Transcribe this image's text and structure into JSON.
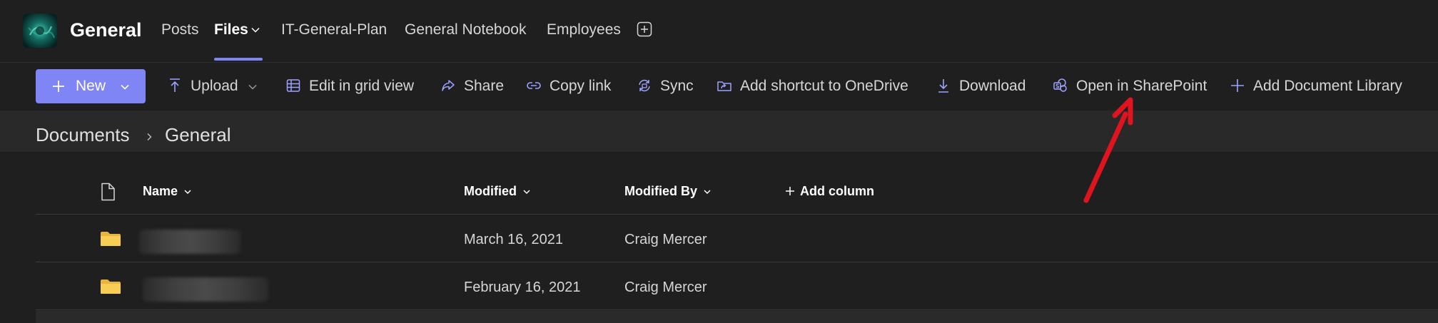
{
  "header": {
    "team_name": "General",
    "tabs": [
      {
        "label": "Posts"
      },
      {
        "label": "Files"
      },
      {
        "label": "IT-General-Plan"
      },
      {
        "label": "General Notebook"
      },
      {
        "label": "Employees"
      }
    ],
    "active_tab": "Files"
  },
  "toolbar": {
    "new_label": "New",
    "upload_label": "Upload",
    "edit_grid_label": "Edit in grid view",
    "share_label": "Share",
    "copy_link_label": "Copy link",
    "sync_label": "Sync",
    "add_shortcut_label": "Add shortcut to OneDrive",
    "download_label": "Download",
    "open_sharepoint_label": "Open in SharePoint",
    "add_library_label": "Add Document Library"
  },
  "breadcrumb": {
    "items": [
      "Documents",
      "General"
    ]
  },
  "file_list": {
    "columns": {
      "name": "Name",
      "modified": "Modified",
      "modified_by": "Modified By",
      "add_column": "Add column"
    },
    "rows": [
      {
        "type": "folder",
        "name": "",
        "modified": "March 16, 2021",
        "modified_by": "Craig Mercer"
      },
      {
        "type": "folder",
        "name": "",
        "modified": "February 16, 2021",
        "modified_by": "Craig Mercer"
      }
    ]
  },
  "colors": {
    "accent": "#7f85f5",
    "background": "#1f1f1f",
    "breadcrumb_bg": "#292929",
    "folder": "#f2c54b",
    "annotation_arrow": "#e0141e"
  },
  "icons": {
    "new": "plus-icon",
    "upload": "upload-icon",
    "edit_grid": "grid-icon",
    "share": "share-icon",
    "copy_link": "link-icon",
    "sync": "sync-icon",
    "add_shortcut": "shortcut-icon",
    "download": "download-icon",
    "open_sharepoint": "sharepoint-icon",
    "add_library": "plus-icon",
    "add_tab": "plus-square-icon",
    "file_type": "document-icon",
    "folder": "folder-icon"
  }
}
